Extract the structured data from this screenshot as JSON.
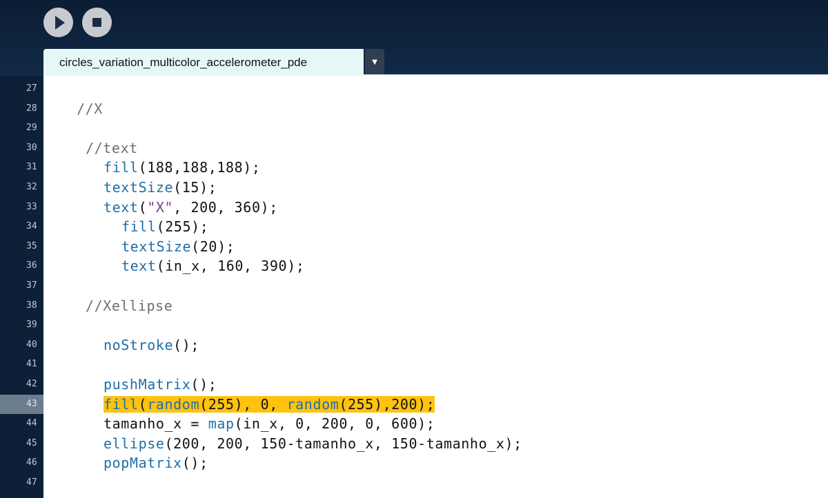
{
  "toolbar": {
    "run_icon": "play-icon",
    "stop_icon": "stop-icon"
  },
  "tabs": {
    "active_tab": "circles_variation_multicolor_accelerometer_pde",
    "menu_glyph": "▼"
  },
  "editor": {
    "current_line": 43,
    "lines": [
      {
        "num": "27",
        "indent": 0,
        "tokens": []
      },
      {
        "num": "28",
        "indent": 48,
        "tokens": [
          {
            "t": "//X",
            "c": "cm"
          }
        ]
      },
      {
        "num": "29",
        "indent": 0,
        "tokens": []
      },
      {
        "num": "30",
        "indent": 61,
        "tokens": [
          {
            "t": "//text",
            "c": "cm"
          }
        ]
      },
      {
        "num": "31",
        "indent": 87,
        "tokens": [
          {
            "t": "fill",
            "c": "kw"
          },
          {
            "t": "(188,188,188);",
            "c": ""
          }
        ]
      },
      {
        "num": "32",
        "indent": 87,
        "tokens": [
          {
            "t": "textSize",
            "c": "kw"
          },
          {
            "t": "(15);",
            "c": ""
          }
        ]
      },
      {
        "num": "33",
        "indent": 87,
        "tokens": [
          {
            "t": "text",
            "c": "kw"
          },
          {
            "t": "(",
            "c": ""
          },
          {
            "t": "\"X\"",
            "c": "str"
          },
          {
            "t": ", 200, 360);",
            "c": ""
          }
        ]
      },
      {
        "num": "34",
        "indent": 113,
        "tokens": [
          {
            "t": "fill",
            "c": "kw"
          },
          {
            "t": "(255);",
            "c": ""
          }
        ]
      },
      {
        "num": "35",
        "indent": 113,
        "tokens": [
          {
            "t": "textSize",
            "c": "kw"
          },
          {
            "t": "(20);",
            "c": ""
          }
        ]
      },
      {
        "num": "36",
        "indent": 113,
        "tokens": [
          {
            "t": "text",
            "c": "kw"
          },
          {
            "t": "(in_x, 160, 390);",
            "c": ""
          }
        ]
      },
      {
        "num": "37",
        "indent": 0,
        "tokens": []
      },
      {
        "num": "38",
        "indent": 61,
        "tokens": [
          {
            "t": "//Xellipse",
            "c": "cm"
          }
        ]
      },
      {
        "num": "39",
        "indent": 0,
        "tokens": []
      },
      {
        "num": "40",
        "indent": 87,
        "tokens": [
          {
            "t": "noStroke",
            "c": "kw"
          },
          {
            "t": "();",
            "c": ""
          }
        ]
      },
      {
        "num": "41",
        "indent": 0,
        "tokens": []
      },
      {
        "num": "42",
        "indent": 87,
        "tokens": [
          {
            "t": "pushMatrix",
            "c": "kw"
          },
          {
            "t": "();",
            "c": ""
          }
        ]
      },
      {
        "num": "43",
        "indent": 87,
        "highlight": true,
        "tokens": [
          {
            "t": "fill",
            "c": "kw"
          },
          {
            "t": "(",
            "c": ""
          },
          {
            "t": "random",
            "c": "kw"
          },
          {
            "t": "(255), 0, ",
            "c": ""
          },
          {
            "t": "random",
            "c": "kw"
          },
          {
            "t": "(255),200);",
            "c": ""
          }
        ]
      },
      {
        "num": "44",
        "indent": 87,
        "tokens": [
          {
            "t": "tamanho_x = ",
            "c": ""
          },
          {
            "t": "map",
            "c": "kw"
          },
          {
            "t": "(in_x, 0, 200, 0, 600);",
            "c": ""
          }
        ]
      },
      {
        "num": "45",
        "indent": 87,
        "tokens": [
          {
            "t": "ellipse",
            "c": "kw"
          },
          {
            "t": "(200, 200, 150-tamanho_x, 150-tamanho_x);",
            "c": ""
          }
        ]
      },
      {
        "num": "46",
        "indent": 87,
        "tokens": [
          {
            "t": "popMatrix",
            "c": "kw"
          },
          {
            "t": "();",
            "c": ""
          }
        ]
      },
      {
        "num": "47",
        "indent": 0,
        "tokens": []
      }
    ]
  }
}
